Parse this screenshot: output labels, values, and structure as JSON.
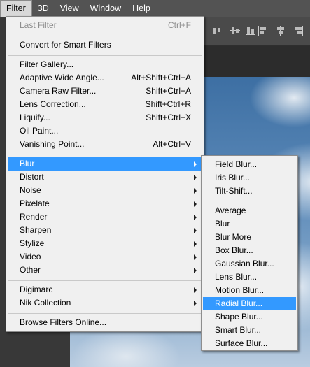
{
  "menubar": {
    "items": [
      {
        "label": "Filter",
        "active": true
      },
      {
        "label": "3D"
      },
      {
        "label": "View"
      },
      {
        "label": "Window"
      },
      {
        "label": "Help"
      }
    ]
  },
  "filter_menu": {
    "last_filter": {
      "label": "Last Filter",
      "shortcut": "Ctrl+F"
    },
    "convert_smart": {
      "label": "Convert for Smart Filters"
    },
    "filter_gallery": {
      "label": "Filter Gallery..."
    },
    "adaptive_wide": {
      "label": "Adaptive Wide Angle...",
      "shortcut": "Alt+Shift+Ctrl+A"
    },
    "camera_raw": {
      "label": "Camera Raw Filter...",
      "shortcut": "Shift+Ctrl+A"
    },
    "lens_correction": {
      "label": "Lens Correction...",
      "shortcut": "Shift+Ctrl+R"
    },
    "liquify": {
      "label": "Liquify...",
      "shortcut": "Shift+Ctrl+X"
    },
    "oil_paint": {
      "label": "Oil Paint..."
    },
    "vanishing_point": {
      "label": "Vanishing Point...",
      "shortcut": "Alt+Ctrl+V"
    },
    "blur": {
      "label": "Blur"
    },
    "distort": {
      "label": "Distort"
    },
    "noise": {
      "label": "Noise"
    },
    "pixelate": {
      "label": "Pixelate"
    },
    "render": {
      "label": "Render"
    },
    "sharpen": {
      "label": "Sharpen"
    },
    "stylize": {
      "label": "Stylize"
    },
    "video": {
      "label": "Video"
    },
    "other": {
      "label": "Other"
    },
    "digimarc": {
      "label": "Digimarc"
    },
    "nik": {
      "label": "Nik Collection"
    },
    "browse_online": {
      "label": "Browse Filters Online..."
    }
  },
  "blur_submenu": {
    "field_blur": "Field Blur...",
    "iris_blur": "Iris Blur...",
    "tilt_shift": "Tilt-Shift...",
    "average": "Average",
    "blur": "Blur",
    "blur_more": "Blur More",
    "box_blur": "Box Blur...",
    "gaussian_blur": "Gaussian Blur...",
    "lens_blur": "Lens Blur...",
    "motion_blur": "Motion Blur...",
    "radial_blur": "Radial Blur...",
    "shape_blur": "Shape Blur...",
    "smart_blur": "Smart Blur...",
    "surface_blur": "Surface Blur..."
  },
  "colors": {
    "highlight": "#3399ff",
    "menu_bg": "#f0f0f0",
    "menubar_bg": "#535353"
  }
}
